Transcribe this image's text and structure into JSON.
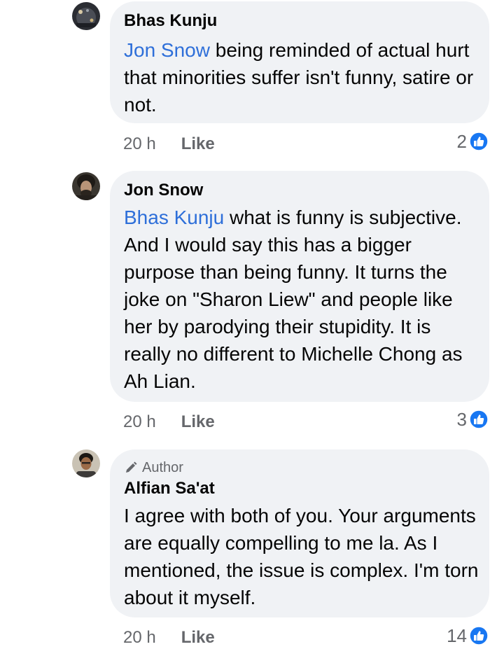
{
  "comments": [
    {
      "author": "Bhas Kunju",
      "mention": "Jon Snow",
      "text": " being reminded of actual hurt that minorities suffer isn't funny, satire or not.",
      "time": "20 h",
      "like_label": "Like",
      "reaction_count": "2",
      "reaction_icon": "like-icon"
    },
    {
      "author": "Jon Snow",
      "mention": "Bhas Kunju",
      "text": " what is funny is subjective. And I would say this has a bigger purpose than being funny. It turns the joke on \"Sharon Liew\" and people like her by parodying their stupidity. It is really no different to Michelle Chong as Ah Lian.",
      "time": "20 h",
      "like_label": "Like",
      "reaction_count": "3",
      "reaction_icon": "like-icon"
    },
    {
      "badge": "Author",
      "author": "Alfian Sa'at",
      "text": "I agree with both of you. Your arguments are equally compelling to me la. As I mentioned, the issue is complex. I'm torn about it myself.",
      "time": "20 h",
      "like_label": "Like",
      "reaction_count": "14",
      "reaction_icon": "like-icon"
    }
  ],
  "colors": {
    "bubble": "#f0f2f5",
    "mention": "#2e6fd9",
    "secondary_text": "#65676b",
    "like_blue": "#1877f2"
  }
}
